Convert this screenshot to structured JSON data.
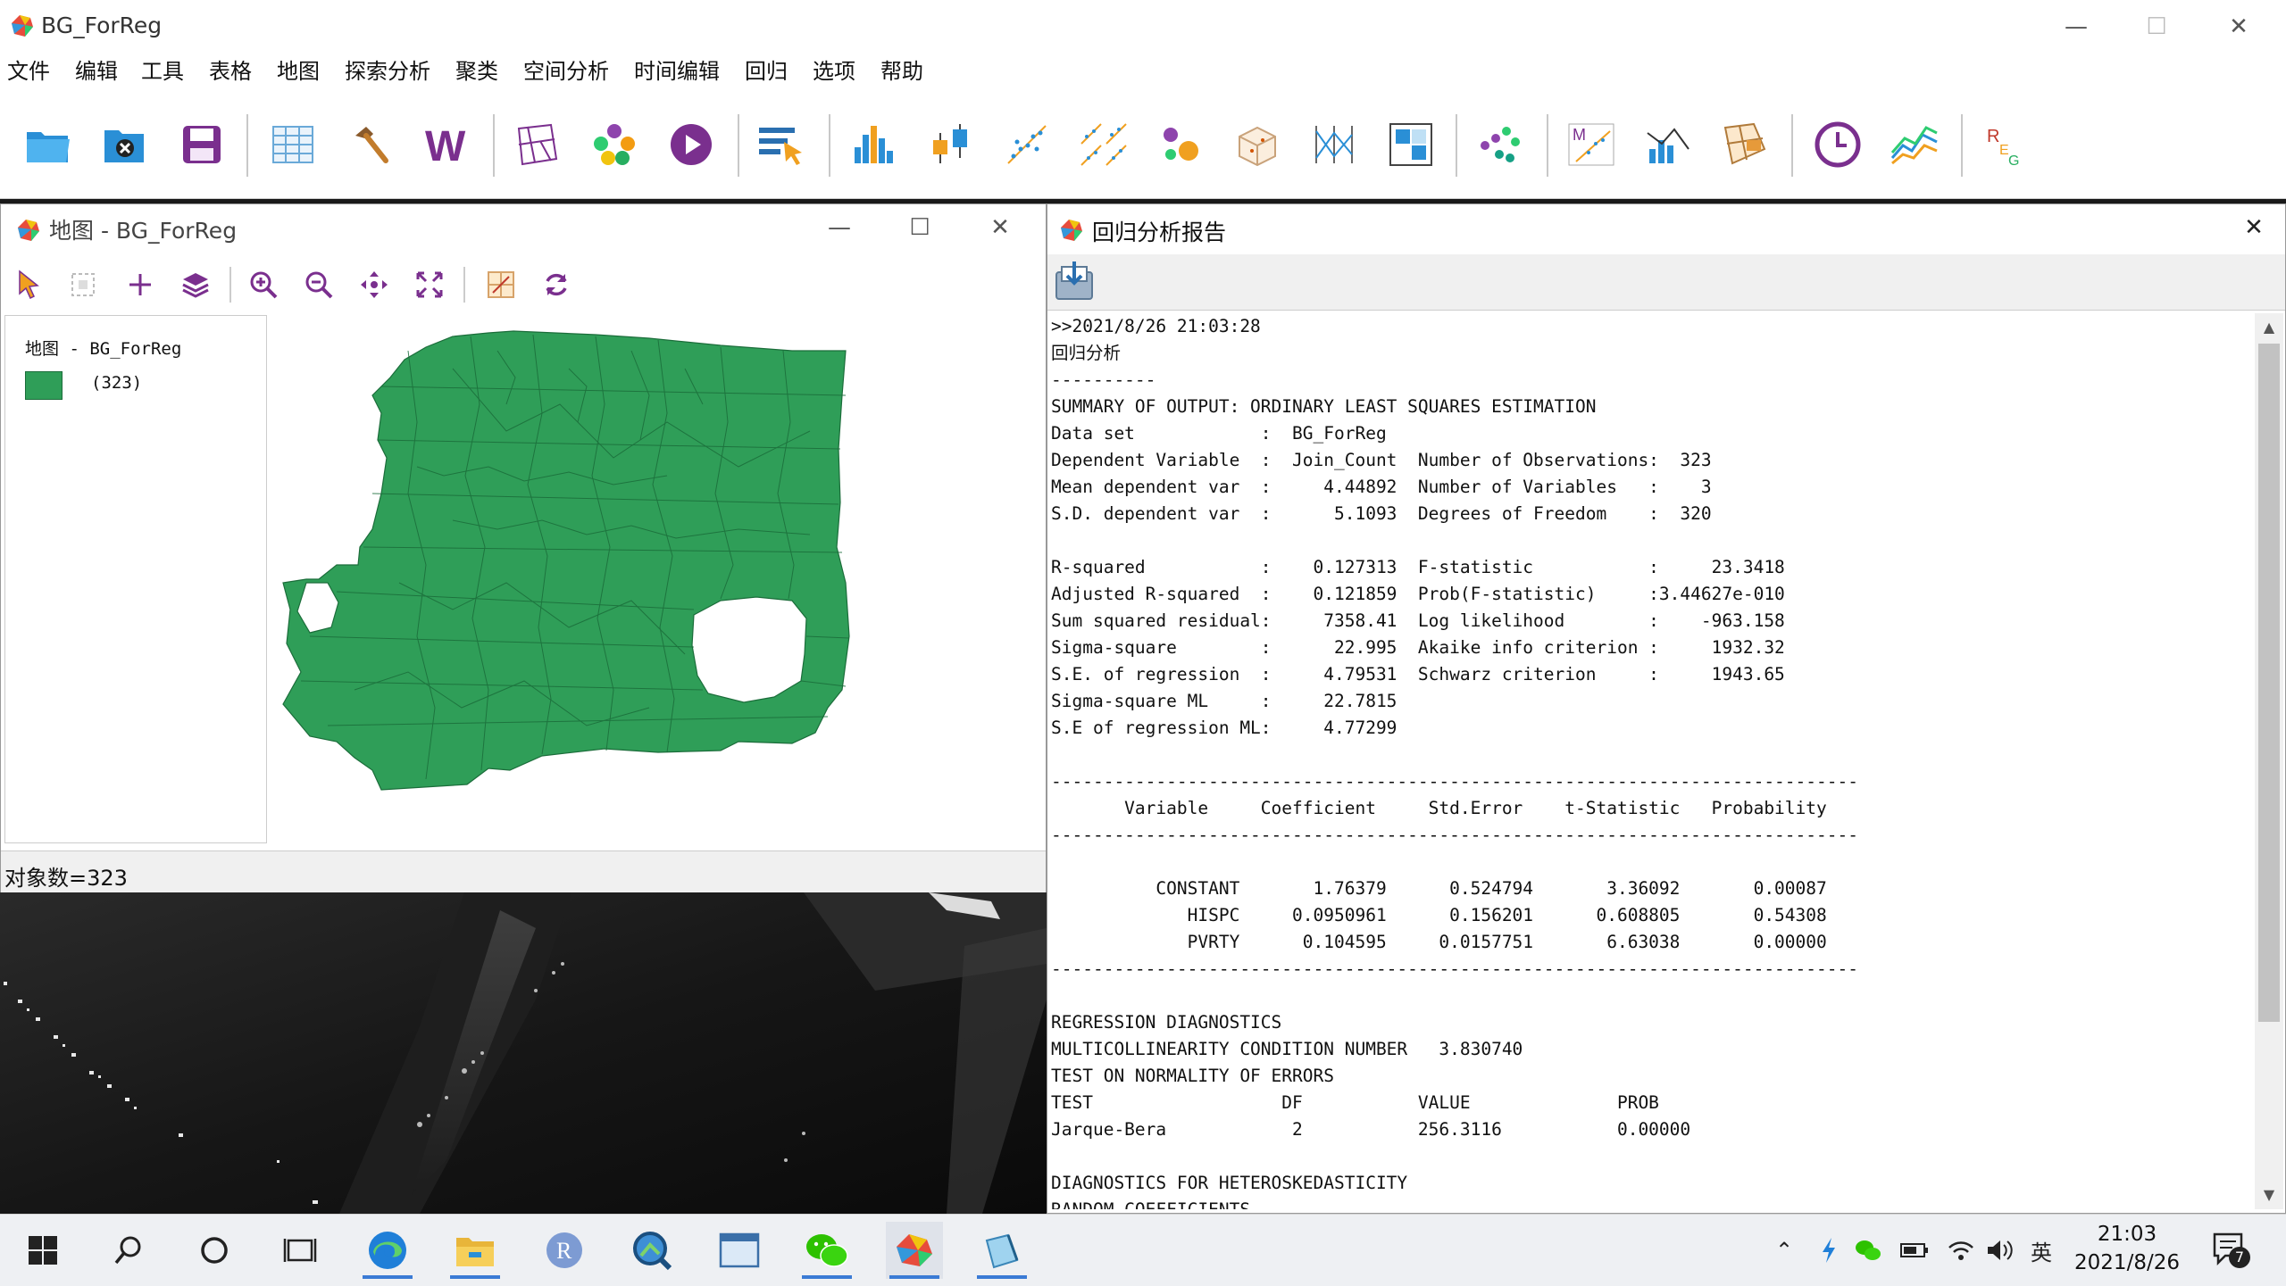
{
  "app": {
    "title": "BG_ForReg",
    "window_controls": {
      "minimize": "—",
      "maximize": "☐",
      "close": "✕"
    }
  },
  "menu": [
    "文件",
    "编辑",
    "工具",
    "表格",
    "地图",
    "探索分析",
    "聚类",
    "空间分析",
    "时间编辑",
    "回归",
    "选项",
    "帮助"
  ],
  "toolbar_icons": [
    "open-folder-icon",
    "close-project-icon",
    "save-icon",
    "table-icon",
    "tools-hammer-icon",
    "weights-icon",
    "map-polygon-icon",
    "cluster-dots-icon",
    "play-icon",
    "select-icon",
    "histogram-icon",
    "box-plot-icon",
    "scatter-plot-icon",
    "scatter-matrix-icon",
    "bubble-chart-icon",
    "3d-plot-icon",
    "parallel-coordinate-icon",
    "conditional-plot-icon",
    "cluster-map-icon",
    "moran-icon",
    "lisa-icon",
    "local-g-icon",
    "time-icon",
    "time-trend-icon",
    "regression-icon"
  ],
  "map_window": {
    "title": "地图 - BG_ForReg",
    "legend_title": "地图 - BG_ForReg",
    "legend_count": "(323)",
    "status": "对象数=323",
    "fill_color": "#2f9e58",
    "controls": {
      "minimize": "—",
      "maximize": "☐",
      "close": "✕"
    }
  },
  "report_window": {
    "title": "回归分析报告",
    "close": "✕",
    "lines": [
      ">>2021/8/26 21:03:28",
      "回归分析",
      "----------",
      "SUMMARY OF OUTPUT: ORDINARY LEAST SQUARES ESTIMATION",
      "Data set            :  BG_ForReg",
      "Dependent Variable  :  Join_Count  Number of Observations:  323",
      "Mean dependent var  :     4.44892  Number of Variables   :    3",
      "S.D. dependent var  :      5.1093  Degrees of Freedom    :  320",
      "",
      "R-squared           :    0.127313  F-statistic           :     23.3418",
      "Adjusted R-squared  :    0.121859  Prob(F-statistic)     :3.44627e-010",
      "Sum squared residual:     7358.41  Log likelihood        :    -963.158",
      "Sigma-square        :      22.995  Akaike info criterion :     1932.32",
      "S.E. of regression  :     4.79531  Schwarz criterion     :     1943.65",
      "Sigma-square ML     :     22.7815",
      "S.E of regression ML:     4.77299",
      "",
      "-----------------------------------------------------------------------------",
      "       Variable     Coefficient     Std.Error    t-Statistic   Probability",
      "-----------------------------------------------------------------------------",
      "",
      "          CONSTANT       1.76379      0.524794       3.36092       0.00087",
      "             HISPC     0.0950961      0.156201      0.608805       0.54308",
      "             PVRTY      0.104595     0.0157751       6.63038       0.00000",
      "-----------------------------------------------------------------------------",
      "",
      "REGRESSION DIAGNOSTICS",
      "MULTICOLLINEARITY CONDITION NUMBER   3.830740",
      "TEST ON NORMALITY OF ERRORS",
      "TEST                  DF           VALUE              PROB",
      "Jarque-Bera            2           256.3116           0.00000",
      "",
      "DIAGNOSTICS FOR HETEROSKEDASTICITY",
      "RANDOM COEFFICIENTS"
    ]
  },
  "taskbar": {
    "clock_time": "21:03",
    "clock_date": "2021/8/26",
    "ime": "英",
    "notification_count": "7",
    "r_app_label": "R"
  }
}
